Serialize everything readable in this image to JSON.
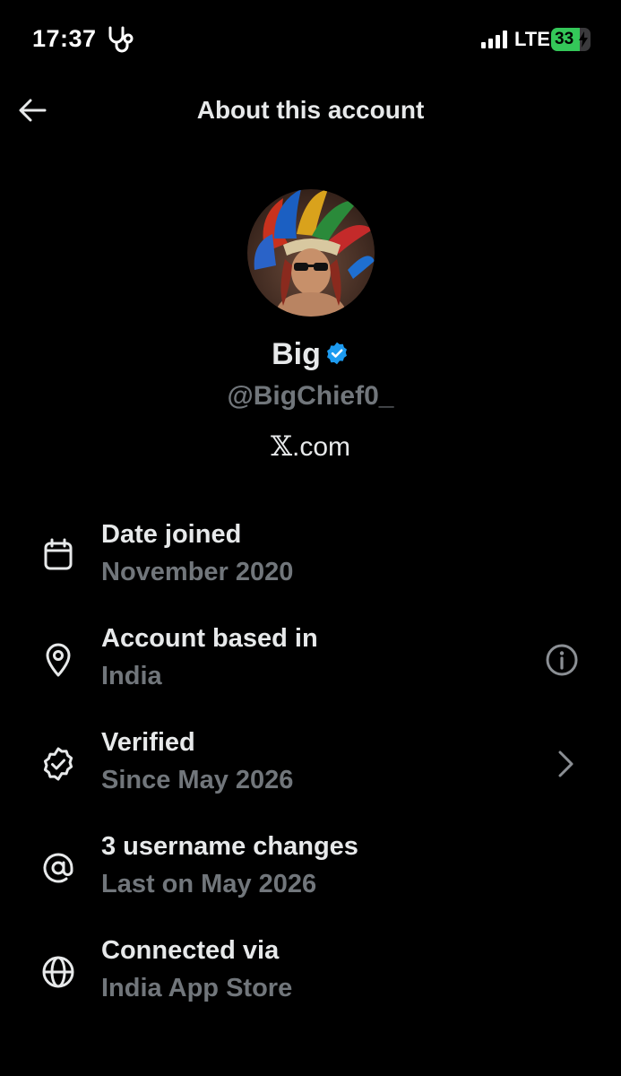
{
  "status_bar": {
    "time": "17:37",
    "network": "LTE",
    "battery": "33",
    "battery_level": 0.33,
    "battery_color": "#34c759"
  },
  "header": {
    "title": "About this account",
    "back_icon": "arrow-left-icon"
  },
  "profile": {
    "display_name": "Big",
    "verified_icon": "verified-badge-icon",
    "verified_color": "#1d9bf0",
    "username": "@BigChief0_",
    "site_x": "𝕏",
    "site_rest": ".com"
  },
  "items": [
    {
      "icon": "calendar-icon",
      "title": "Date joined",
      "subtitle": "November 2020"
    },
    {
      "icon": "location-pin-icon",
      "title": "Account based in",
      "subtitle": "India",
      "trailing_icon": "info-icon"
    },
    {
      "icon": "verified-outline-icon",
      "title": "Verified",
      "subtitle": "Since May 2026",
      "trailing_icon": "chevron-right-icon"
    },
    {
      "icon": "at-sign-icon",
      "title": "3 username changes",
      "subtitle": "Last on May 2026"
    },
    {
      "icon": "globe-icon",
      "title": "Connected via",
      "subtitle": "India App Store"
    }
  ],
  "colors": {
    "background": "#000000",
    "primary_text": "#e7e9ea",
    "secondary_text": "#71767b"
  }
}
